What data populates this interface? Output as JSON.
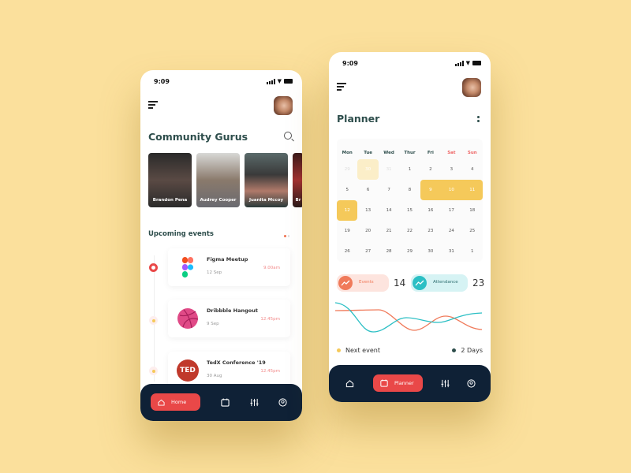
{
  "status_time": "9:09",
  "community": {
    "title": "Community Gurus",
    "gurus": [
      {
        "name": "Brandon Pena",
        "color": "#3a3a3a"
      },
      {
        "name": "Audrey Cooper",
        "color": "#9a9a98"
      },
      {
        "name": "Juanita Mccoy",
        "color": "#4a5a5c"
      },
      {
        "name": "Br",
        "color": "#5a2a2a"
      }
    ],
    "upcoming_title": "Upcoming events",
    "events": [
      {
        "name": "Figma Meetup",
        "date": "12 Sep",
        "time": "9.00am",
        "icon": "figma-icon"
      },
      {
        "name": "Dribbble Hangout",
        "date": "9 Sep",
        "time": "12.45pm",
        "icon": "dribbble-icon"
      },
      {
        "name": "TedX Conference '19",
        "date": "30 Aug",
        "time": "12.45pm",
        "icon": "ted-icon",
        "logo_text": "TED"
      }
    ],
    "nav_active": "Home"
  },
  "planner": {
    "title": "Planner",
    "weekdays": [
      "Mon",
      "Tue",
      "Wed",
      "Thur",
      "Fri",
      "Sat",
      "Sun"
    ],
    "weeks": [
      [
        "29",
        "30",
        "31",
        "1",
        "2",
        "3",
        "4"
      ],
      [
        "5",
        "6",
        "7",
        "8",
        "9",
        "10",
        "11"
      ],
      [
        "12",
        "13",
        "14",
        "15",
        "16",
        "17",
        "18"
      ],
      [
        "19",
        "20",
        "21",
        "22",
        "23",
        "24",
        "25"
      ],
      [
        "26",
        "27",
        "28",
        "29",
        "30",
        "31",
        "1"
      ]
    ],
    "stats": {
      "events_label": "Events",
      "events_value": "14",
      "attendance_label": "Attendance",
      "attendance_value": "23"
    },
    "next_event_label": "Next event",
    "next_event_value": "2 Days",
    "nav_active": "Planner"
  },
  "colors": {
    "accent": "#e94848",
    "nav_bg": "#0f2136",
    "highlight": "#f5c95a",
    "events": "#f07a5a",
    "attendance": "#2bbfc4",
    "bg": "#fbe09c"
  }
}
